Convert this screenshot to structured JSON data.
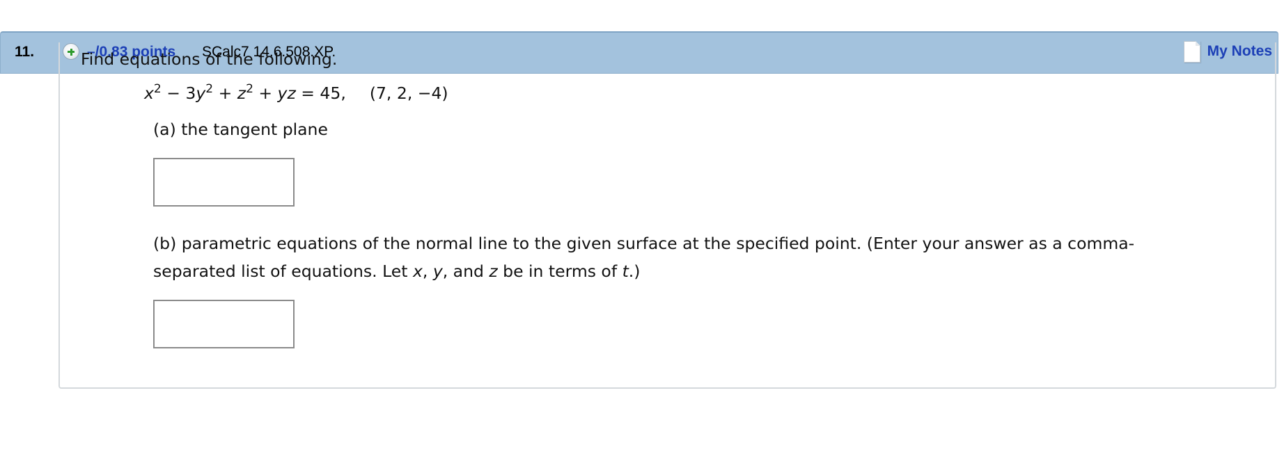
{
  "question": {
    "number": "11.",
    "points": "–/0.83 points",
    "reference": "SCalc7 14.6.508.XP.",
    "my_notes_label": "My Notes",
    "intro": "Find equations of the following.",
    "equation": {
      "x_var": "x",
      "term2_coef": " − 3",
      "y_var": "y",
      "term3_op": " + ",
      "z_var": "z",
      "term4_op": " + ",
      "yz": "yz",
      "rhs": " = 45,",
      "point": "(7, 2, −4)",
      "exp": "2"
    },
    "part_a": "(a) the tangent plane",
    "part_b": {
      "line1": "(b) parametric equations of the normal line to the given surface at the specified point. (Enter your answer as a comma-",
      "line2_prefix": "separated list of equations. Let ",
      "var_x": "x",
      "sep1": ", ",
      "var_y": "y",
      "sep2": ", and ",
      "var_z": "z",
      "line2_mid": " be in terms of ",
      "var_t": "t",
      "line2_suffix": ".)"
    },
    "answer_a_value": "",
    "answer_b_value": ""
  },
  "icons": {
    "expand": "plus-circle-icon",
    "notes": "note-page-icon"
  },
  "colors": {
    "header_bg": "#a3c2dd",
    "link_blue": "#1c3fb6",
    "plus_green": "#2e9b2e"
  }
}
